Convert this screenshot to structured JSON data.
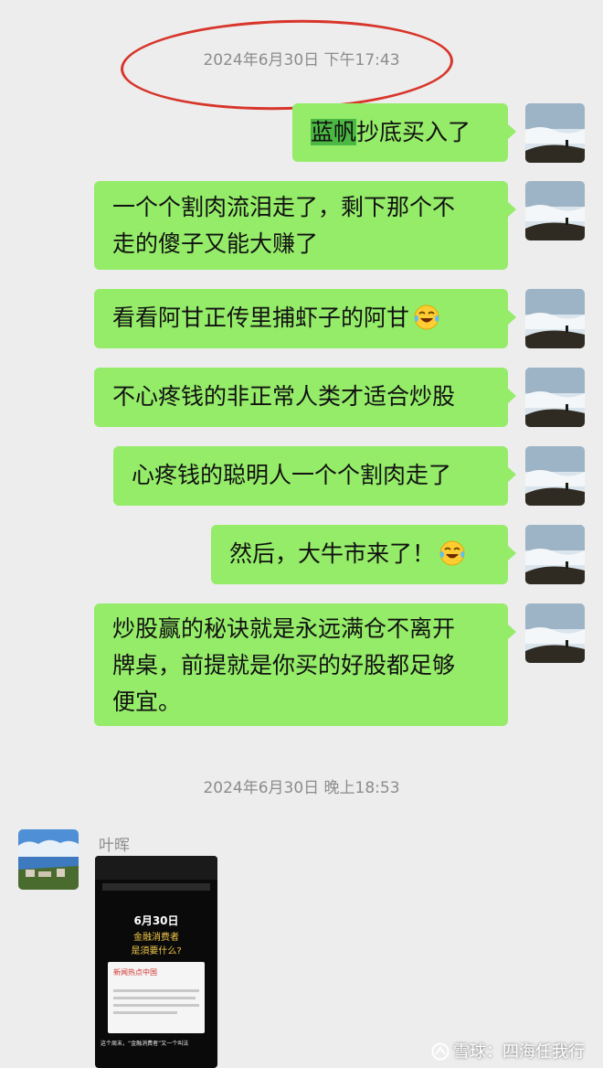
{
  "timestamps": {
    "first": "2024年6月30日 下午17:43",
    "second": "2024年6月30日 晚上18:53"
  },
  "messages": [
    {
      "highlight": "蓝帆",
      "rest": "抄底买入了"
    },
    {
      "line1": "一个个割肉流泪走了，剩下那个不",
      "line2": "走的傻子又能大赚了"
    },
    {
      "text": "看看阿甘正传里捕虾子的阿甘"
    },
    {
      "text": "不心疼钱的非正常人类才适合炒股"
    },
    {
      "text": "心疼钱的聪明人一个个割肉走了"
    },
    {
      "text": "然后，大牛市来了！"
    },
    {
      "line1": "炒股赢的秘诀就是永远满仓不离开",
      "line2": "牌桌，前提就是你买的好股都足够",
      "line3": "便宜。"
    }
  ],
  "peer": {
    "name": "叶晖",
    "image": {
      "date": "6月30日",
      "line1": "金融消费者",
      "line2": "是須要什么?",
      "card_title": "新闻热点中国",
      "bottom": "这个周末，“金融消费者”又一个叫法"
    }
  },
  "watermark": "雪球：四海任我行",
  "colors": {
    "background": "#ededed",
    "bubble": "#95ec69",
    "highlight": "#4cb844",
    "annotation_circle": "#d8352b"
  },
  "icons": [
    "landscape-avatar-icon",
    "tears-of-joy-emoji",
    "xueqiu-logo-icon"
  ]
}
